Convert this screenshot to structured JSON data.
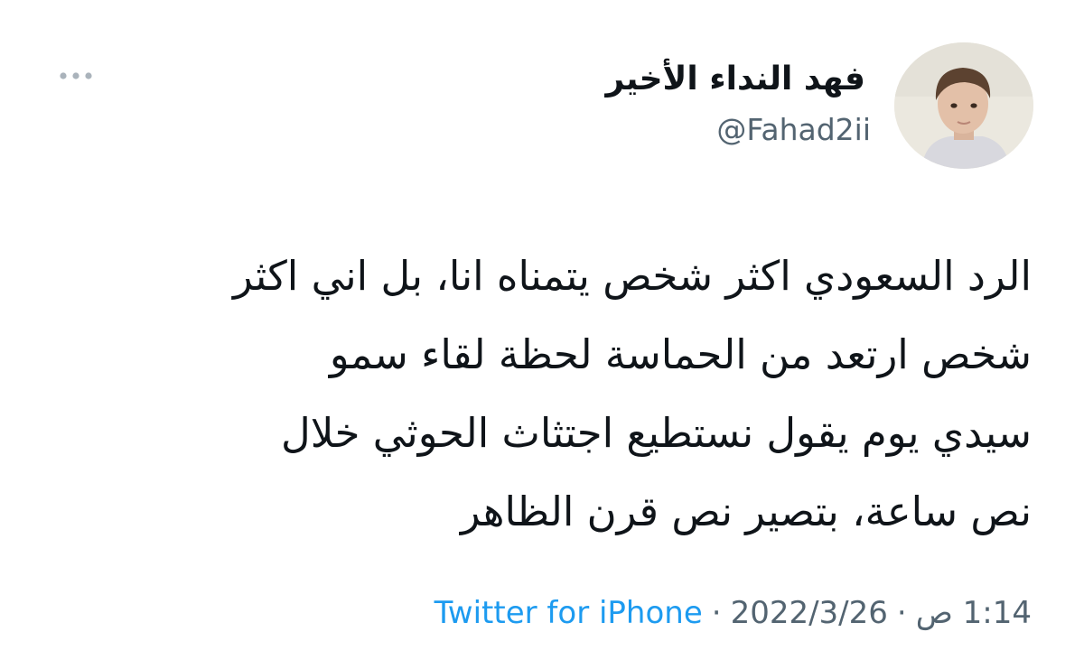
{
  "tweet": {
    "display_name": "فهد النداء الأخير",
    "handle": "@Fahad2ii",
    "more_icon": "more-horizontal-icon",
    "avatar_icon": "profile-photo",
    "text_lines": [
      "الرد السعودي اكثر شخص يتمناه انا، بل اني اكثر",
      "شخص ارتعد من الحماسة لحظة لقاء سمو",
      "سيدي يوم يقول نستطيع اجتثاث الحوثي خلال",
      "نص ساعة، بتصير نص قرن الظاهر"
    ],
    "time": "1:14 ص",
    "date": "2022/3/26",
    "separator": "·",
    "source": "Twitter for iPhone"
  },
  "colors": {
    "text": "#0f1419",
    "secondary": "#536471",
    "link": "#1d9bf0"
  }
}
